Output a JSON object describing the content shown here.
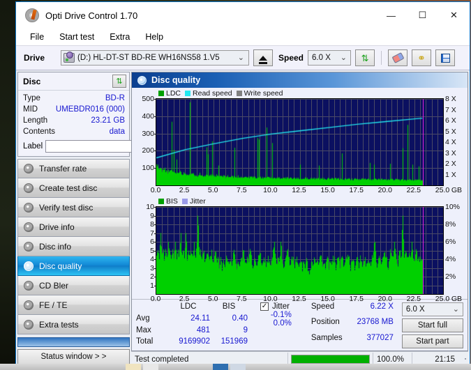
{
  "window": {
    "title": "Opti Drive Control 1.70",
    "title_icon": "disc-icon",
    "minimize": "—",
    "maximize": "☐",
    "close": "✕"
  },
  "menu": {
    "items": [
      "File",
      "Start test",
      "Extra",
      "Help"
    ]
  },
  "toolbar": {
    "drive_label": "Drive",
    "drive_value": "(D:)  HL-DT-ST BD-RE  WH16NS58 1.V5",
    "eject_icon": "eject-icon",
    "speed_label": "Speed",
    "speed_value": "6.0 X",
    "refresh_icon": "refresh-icon",
    "erase_icon": "eraser-icon",
    "key_icon": "key-icon",
    "save_icon": "save-icon",
    "caret": "⌄"
  },
  "disc": {
    "header": "Disc",
    "refresh_icon": "refresh-icon",
    "rows": [
      {
        "key": "Type",
        "value": "BD-R"
      },
      {
        "key": "MID",
        "value": "UMEBDR016 (000)"
      },
      {
        "key": "Length",
        "value": "23.21 GB"
      },
      {
        "key": "Contents",
        "value": "data"
      }
    ],
    "label_key": "Label",
    "label_value": "",
    "label_placeholder": "",
    "cd_icon": "cd-icon"
  },
  "nav": {
    "items": [
      {
        "label": "Transfer rate",
        "icon": "disc-icon",
        "active": false
      },
      {
        "label": "Create test disc",
        "icon": "disc-icon",
        "active": false
      },
      {
        "label": "Verify test disc",
        "icon": "disc-icon",
        "active": false
      },
      {
        "label": "Drive info",
        "icon": "disc-icon",
        "active": false
      },
      {
        "label": "Disc info",
        "icon": "disc-icon",
        "active": false
      },
      {
        "label": "Disc quality",
        "icon": "disc-icon",
        "active": true
      },
      {
        "label": "CD Bler",
        "icon": "disc-icon",
        "active": false
      },
      {
        "label": "FE / TE",
        "icon": "disc-icon",
        "active": false
      },
      {
        "label": "Extra tests",
        "icon": "disc-icon",
        "active": false
      }
    ],
    "status_window_button": "Status window > >"
  },
  "content": {
    "header": "Disc quality",
    "header_icon": "disc-icon"
  },
  "stats": {
    "columns": [
      "LDC",
      "BIS"
    ],
    "rows": [
      {
        "label": "Avg",
        "ldc": "24.11",
        "bis": "0.40"
      },
      {
        "label": "Max",
        "ldc": "481",
        "bis": "9"
      },
      {
        "label": "Total",
        "ldc": "9169902",
        "bis": "151969"
      }
    ],
    "jitter_label": "Jitter",
    "jitter_checked": true,
    "jitter_values": [
      "-0.1%",
      "0.0%"
    ],
    "info": [
      {
        "key": "Speed",
        "value": "6.22 X"
      },
      {
        "key": "Position",
        "value": "23768 MB"
      },
      {
        "key": "Samples",
        "value": "377027"
      }
    ],
    "speed_select": "6.0 X",
    "start_full": "Start full",
    "start_part": "Start part"
  },
  "statusbar": {
    "message": "Test completed",
    "progress_percent": 100.0,
    "progress_text": "100.0%",
    "time": "21:15"
  },
  "chart_data": [
    {
      "type": "area",
      "name": "ldc-chart",
      "title": "",
      "xlabel": "GB",
      "ylabel": "",
      "xlim": [
        0,
        25
      ],
      "ylim": [
        0,
        500
      ],
      "y2lim": [
        0,
        8
      ],
      "y2label": "X",
      "grid": true,
      "legend": [
        {
          "label": "LDC",
          "color": "#00a000"
        },
        {
          "label": "Read speed",
          "color": "#22e8f0"
        },
        {
          "label": "Write speed",
          "color": "#808080"
        }
      ],
      "xticks": [
        "0.0",
        "2.5",
        "5.0",
        "7.5",
        "10.0",
        "12.5",
        "15.0",
        "17.5",
        "20.0",
        "22.5",
        "25.0"
      ],
      "yticks": [
        500,
        400,
        300,
        200,
        100
      ],
      "y2ticks": [
        "8 X",
        "7 X",
        "6 X",
        "5 X",
        "4 X",
        "3 X",
        "2 X",
        "1 X"
      ],
      "data_end_gb": 23.21,
      "series": [
        {
          "name": "LDC",
          "color": "#00d000",
          "baseline": [
            115,
            108,
            96,
            92,
            88,
            84,
            96,
            82,
            78,
            80,
            74,
            86,
            78,
            70,
            76,
            72,
            74,
            88,
            70,
            66,
            72,
            68,
            70,
            62,
            66,
            74,
            60,
            64,
            58,
            62,
            60,
            56,
            68,
            58,
            54,
            60,
            56,
            58,
            52,
            56,
            54,
            58,
            50,
            54,
            52,
            56,
            50,
            48,
            54,
            50,
            52,
            48,
            50,
            54,
            48,
            46,
            52,
            48,
            50,
            46,
            48,
            52,
            46,
            50,
            48,
            44,
            50,
            46,
            48,
            44,
            46,
            50,
            44,
            48,
            46,
            42,
            48,
            44,
            46,
            42,
            44,
            48,
            42,
            46,
            44,
            40,
            46,
            42,
            44,
            40,
            42,
            46,
            40,
            44,
            42,
            40,
            44,
            40,
            42,
            38,
            40,
            44,
            38,
            42,
            40,
            38,
            42,
            38,
            40,
            36,
            40,
            42,
            38,
            40,
            36,
            38,
            42,
            38,
            40,
            36,
            38,
            40,
            36,
            38,
            40,
            36,
            38,
            34,
            38,
            40,
            36,
            38,
            34,
            36,
            40,
            36,
            38,
            34,
            36,
            38,
            34,
            36,
            32,
            36,
            38,
            34,
            36,
            32,
            36,
            38,
            34,
            36,
            32,
            34,
            38,
            34,
            36,
            32,
            34,
            36,
            32,
            34,
            30,
            34,
            36,
            32,
            34,
            30,
            34,
            36,
            32,
            34,
            30,
            32,
            36,
            32,
            34,
            30,
            32,
            34,
            30,
            32,
            28,
            32,
            34,
            30,
            32,
            28,
            32,
            34,
            30,
            32,
            28,
            30,
            34,
            30,
            32,
            28,
            30,
            32
          ],
          "spikes": [
            {
              "x": 1.35,
              "y": 368
            },
            {
              "x": 1.55,
              "y": 205
            },
            {
              "x": 1.75,
              "y": 150
            },
            {
              "x": 2.95,
              "y": 481
            },
            {
              "x": 4.4,
              "y": 220
            },
            {
              "x": 4.5,
              "y": 180
            },
            {
              "x": 4.85,
              "y": 255
            },
            {
              "x": 5.4,
              "y": 115
            },
            {
              "x": 6.8,
              "y": 218
            },
            {
              "x": 8.8,
              "y": 275
            },
            {
              "x": 8.95,
              "y": 265
            },
            {
              "x": 9.6,
              "y": 335
            },
            {
              "x": 10.1,
              "y": 245
            },
            {
              "x": 12.5,
              "y": 120
            },
            {
              "x": 14.2,
              "y": 115
            },
            {
              "x": 16.2,
              "y": 185
            },
            {
              "x": 18.6,
              "y": 130
            },
            {
              "x": 19.0,
              "y": 120
            },
            {
              "x": 20.4,
              "y": 125
            },
            {
              "x": 21.5,
              "y": 215
            },
            {
              "x": 21.9,
              "y": 350
            },
            {
              "x": 22.3,
              "y": 120
            },
            {
              "x": 22.9,
              "y": 110
            }
          ]
        },
        {
          "name": "Read speed",
          "color": "#22e8f0",
          "axis": "right",
          "points": [
            {
              "x": 0.0,
              "y": 2.55
            },
            {
              "x": 2.5,
              "y": 3.3
            },
            {
              "x": 5.0,
              "y": 3.85
            },
            {
              "x": 7.5,
              "y": 4.35
            },
            {
              "x": 10.0,
              "y": 4.75
            },
            {
              "x": 12.5,
              "y": 5.05
            },
            {
              "x": 15.0,
              "y": 5.35
            },
            {
              "x": 17.5,
              "y": 5.65
            },
            {
              "x": 20.0,
              "y": 5.9
            },
            {
              "x": 22.5,
              "y": 6.15
            },
            {
              "x": 23.2,
              "y": 6.22
            }
          ]
        }
      ]
    },
    {
      "type": "area",
      "name": "bis-chart",
      "title": "",
      "xlabel": "GB",
      "ylabel": "",
      "xlim": [
        0,
        25
      ],
      "ylim": [
        0,
        10
      ],
      "y2lim": [
        0,
        10
      ],
      "y2label": "%",
      "grid": true,
      "legend": [
        {
          "label": "BIS",
          "color": "#00a000"
        },
        {
          "label": "Jitter",
          "color": "#9a9ae8"
        }
      ],
      "xticks": [
        "0.0",
        "2.5",
        "5.0",
        "7.5",
        "10.0",
        "12.5",
        "15.0",
        "17.5",
        "20.0",
        "22.5",
        "25.0"
      ],
      "yticks": [
        10,
        9,
        8,
        7,
        6,
        5,
        4,
        3,
        2,
        1
      ],
      "y2ticks": [
        "10%",
        "8%",
        "6%",
        "4%",
        "2%"
      ],
      "data_end_gb": 23.21,
      "series": [
        {
          "name": "BIS",
          "color": "#00d000",
          "baseline": [
            4,
            5,
            4,
            7,
            4,
            5,
            4,
            5,
            4,
            6,
            5,
            4,
            5,
            4,
            6,
            4,
            5,
            4,
            7,
            4,
            5,
            4,
            7,
            4,
            5,
            4,
            5,
            4,
            6,
            4,
            5,
            9,
            4,
            5,
            4,
            5,
            4,
            4,
            5,
            4,
            4,
            5,
            4,
            4,
            5,
            4,
            4,
            3,
            4,
            3,
            4,
            3,
            4,
            4,
            3,
            4,
            3,
            4,
            5,
            4,
            3,
            4,
            3,
            4,
            4,
            5,
            4,
            3,
            4,
            4,
            5,
            4,
            3,
            4,
            4,
            3,
            4,
            5,
            4,
            3,
            4,
            4,
            3,
            4,
            4,
            3,
            4,
            5,
            6,
            4,
            3,
            4,
            4,
            6,
            4,
            3,
            4,
            4,
            5,
            4,
            3,
            4,
            4,
            3,
            4,
            4,
            3,
            4,
            4,
            3,
            4,
            3,
            4,
            3,
            2,
            3,
            4,
            3,
            4,
            3,
            4,
            3,
            4,
            4,
            3,
            4,
            3,
            4,
            4,
            3,
            4,
            3,
            4,
            4,
            3,
            4,
            4,
            3,
            4,
            4,
            3,
            4,
            4,
            5,
            4,
            3,
            4,
            4,
            3,
            4,
            4,
            3,
            4,
            4,
            3,
            4,
            4,
            3,
            4,
            4,
            3,
            4,
            4,
            6,
            4,
            3,
            4,
            4,
            3,
            4,
            5,
            4,
            4,
            3,
            4,
            5,
            4,
            4,
            6,
            4,
            3,
            4,
            5,
            4,
            9,
            4,
            5,
            4,
            4,
            5,
            4,
            6,
            4,
            4,
            5,
            4,
            4,
            4,
            4,
            4
          ]
        }
      ]
    }
  ]
}
